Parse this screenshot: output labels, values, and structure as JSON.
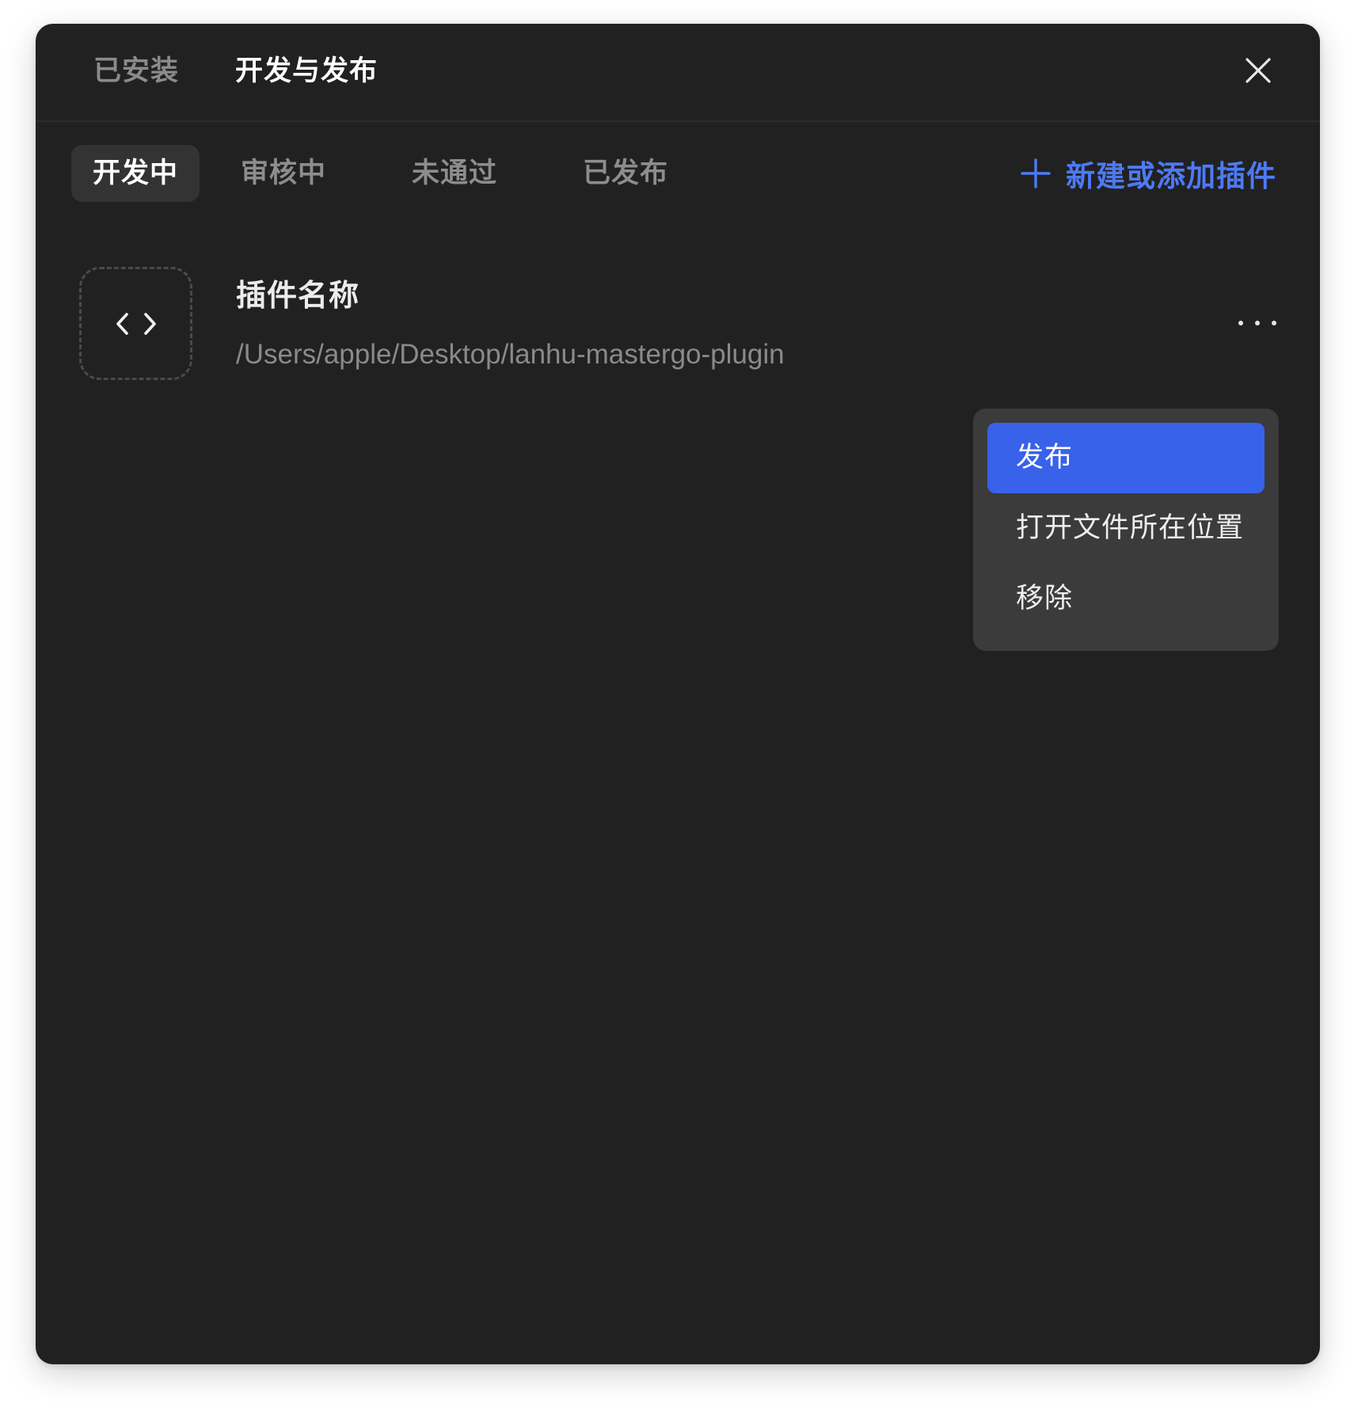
{
  "header": {
    "tabs": [
      {
        "label": "已安装",
        "active": false
      },
      {
        "label": "开发与发布",
        "active": true
      }
    ],
    "close_icon": "close-icon"
  },
  "subtabs": {
    "items": [
      {
        "label": "开发中",
        "active": true
      },
      {
        "label": "审核中",
        "active": false
      },
      {
        "label": "未通过",
        "active": false
      },
      {
        "label": "已发布",
        "active": false
      }
    ],
    "add_button": {
      "icon": "plus-icon",
      "label": "新建或添加插件"
    }
  },
  "plugin": {
    "icon": "code-brackets-icon",
    "name": "插件名称",
    "path": "/Users/apple/Desktop/lanhu-mastergo-plugin",
    "more_icon": "more-horizontal-icon"
  },
  "context_menu": {
    "items": [
      {
        "label": "发布",
        "highlighted": true
      },
      {
        "label": "打开文件所在位置",
        "highlighted": false
      },
      {
        "label": "移除",
        "highlighted": false
      }
    ]
  },
  "colors": {
    "background": "#212121",
    "accent": "#3862ea",
    "link": "#4d7af5",
    "menu_bg": "#3b3b3b",
    "active_tab_bg": "#333333"
  }
}
